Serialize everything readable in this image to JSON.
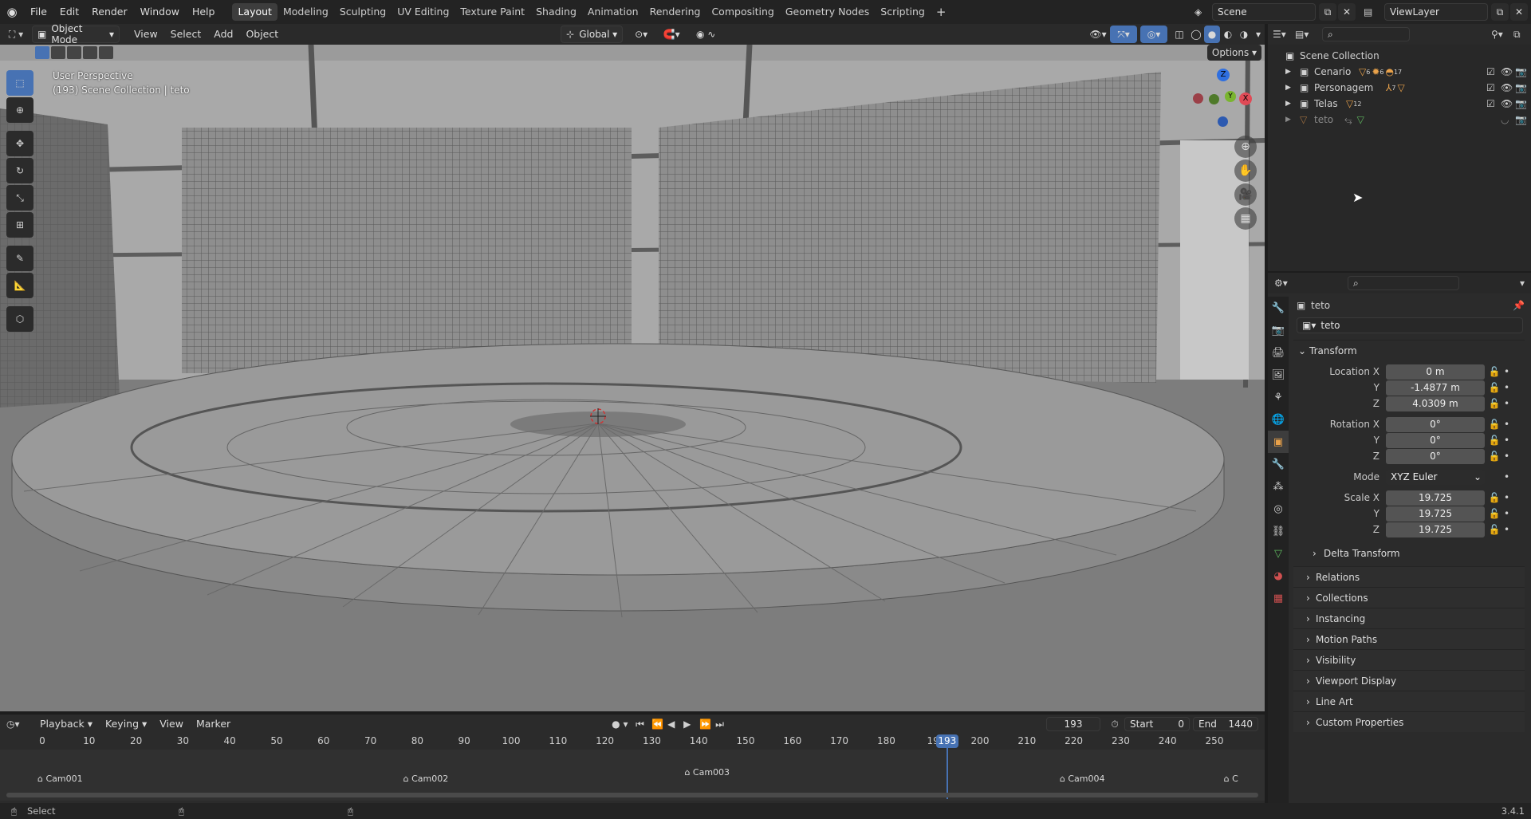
{
  "topbar": {
    "menus": [
      "File",
      "Edit",
      "Render",
      "Window",
      "Help"
    ],
    "workspaces": [
      "Layout",
      "Modeling",
      "Sculpting",
      "UV Editing",
      "Texture Paint",
      "Shading",
      "Animation",
      "Rendering",
      "Compositing",
      "Geometry Nodes",
      "Scripting"
    ],
    "active_workspace": "Layout",
    "add_workspace": "+",
    "scene": "Scene",
    "view_layer": "ViewLayer"
  },
  "viewport_header": {
    "mode": "Object Mode",
    "menus": [
      "View",
      "Select",
      "Add",
      "Object"
    ],
    "orientation": "Global",
    "options": "Options"
  },
  "viewport": {
    "perspective": "User Perspective",
    "collection_info": "(193) Scene Collection | teto",
    "gizmo": {
      "z": "Z",
      "y": "Y",
      "x": "X"
    }
  },
  "outliner": {
    "root": "Scene Collection",
    "items": [
      {
        "name": "Cenario",
        "badge1": "6",
        "badge2": "6",
        "badge3": "17"
      },
      {
        "name": "Personagem",
        "badge1": "7",
        "badge2": "",
        "badge3": ""
      },
      {
        "name": "Telas",
        "badge1": "12",
        "badge2": "",
        "badge3": ""
      },
      {
        "name": "teto",
        "badge1": "",
        "badge2": "",
        "badge3": ""
      }
    ]
  },
  "properties": {
    "object_name": "teto",
    "datablock": "teto",
    "transform_title": "Transform",
    "location": {
      "label_x": "Location X",
      "label_y": "Y",
      "label_z": "Z",
      "x": "0 m",
      "y": "-1.4877 m",
      "z": "4.0309 m"
    },
    "rotation": {
      "label_x": "Rotation X",
      "label_y": "Y",
      "label_z": "Z",
      "x": "0°",
      "y": "0°",
      "z": "0°"
    },
    "mode_label": "Mode",
    "mode_value": "XYZ Euler",
    "scale": {
      "label_x": "Scale X",
      "label_y": "Y",
      "label_z": "Z",
      "x": "19.725",
      "y": "19.725",
      "z": "19.725"
    },
    "delta_transform": "Delta Transform",
    "panels": [
      "Relations",
      "Collections",
      "Instancing",
      "Motion Paths",
      "Visibility",
      "Viewport Display",
      "Line Art",
      "Custom Properties"
    ]
  },
  "timeline": {
    "menus": [
      "Playback",
      "Keying",
      "View",
      "Marker"
    ],
    "current_frame": "193",
    "start_label": "Start",
    "start": "0",
    "end_label": "End",
    "end": "1440",
    "ticks": [
      "0",
      "10",
      "20",
      "30",
      "40",
      "50",
      "60",
      "70",
      "80",
      "90",
      "100",
      "110",
      "120",
      "130",
      "140",
      "150",
      "160",
      "170",
      "180",
      "19",
      "200",
      "210",
      "220",
      "230",
      "240",
      "250"
    ],
    "playhead": "193",
    "markers": [
      "Cam001",
      "Cam002",
      "Cam003",
      "Cam004",
      "C"
    ]
  },
  "statusbar": {
    "left": "Select",
    "version": "3.4.1"
  }
}
